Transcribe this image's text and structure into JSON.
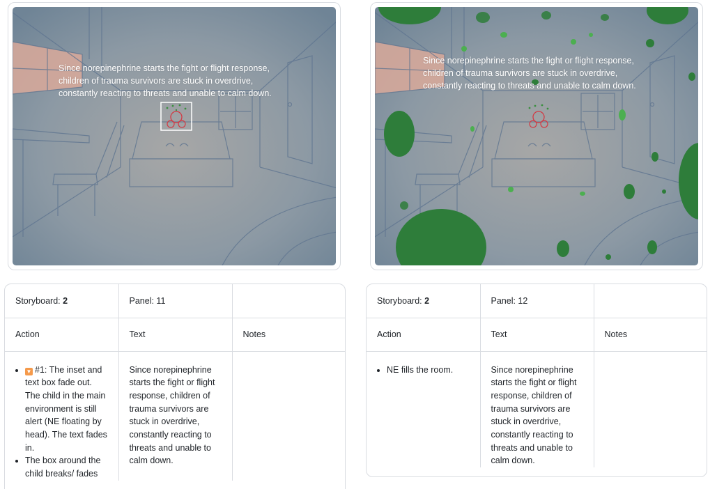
{
  "panels": [
    {
      "image": {
        "overlay_text": "Since norepinephrine starts the fight or flight response,\nchildren of trauma survivors are stuck in overdrive,\nconstantly reacting to threats and unable to calm down."
      },
      "storyboard_label": "Storyboard: ",
      "storyboard_value": "2",
      "panel_label": "Panel: 11",
      "headers": {
        "action": "Action",
        "text": "Text",
        "notes": "Notes"
      },
      "action_items": [
        {
          "icon": "down-arrow-emoji-icon",
          "text": "#1: The inset and text box fade out. The child in the main environment is still alert (NE floating by head). The text fades in."
        },
        {
          "text": "The box around the child breaks/ fades"
        }
      ],
      "text_body": "Since norepinephrine starts the fight or flight response, children of trauma survivors are stuck in overdrive, constantly reacting to threats and unable to calm down.",
      "notes_body": ""
    },
    {
      "image": {
        "overlay_text": "Since norepinephrine starts the fight or flight response,\nchildren of trauma survivors are stuck in overdrive,\nconstantly reacting to threats and unable to calm down."
      },
      "storyboard_label": "Storyboard: ",
      "storyboard_value": "2",
      "panel_label": "Panel: 12",
      "headers": {
        "action": "Action",
        "text": "Text",
        "notes": "Notes"
      },
      "action_items": [
        {
          "text": "NE fills the room."
        }
      ],
      "text_body": "Since norepinephrine starts the fight or flight response, children of trauma survivors are stuck in overdrive, constantly reacting to threats and unable to calm down.",
      "notes_body": ""
    }
  ],
  "colors": {
    "room_wall": "#7d8fa1",
    "window_glow": "#d9a99a",
    "ne_blob": "#2e7d3a",
    "child_outline": "#d23a44"
  }
}
